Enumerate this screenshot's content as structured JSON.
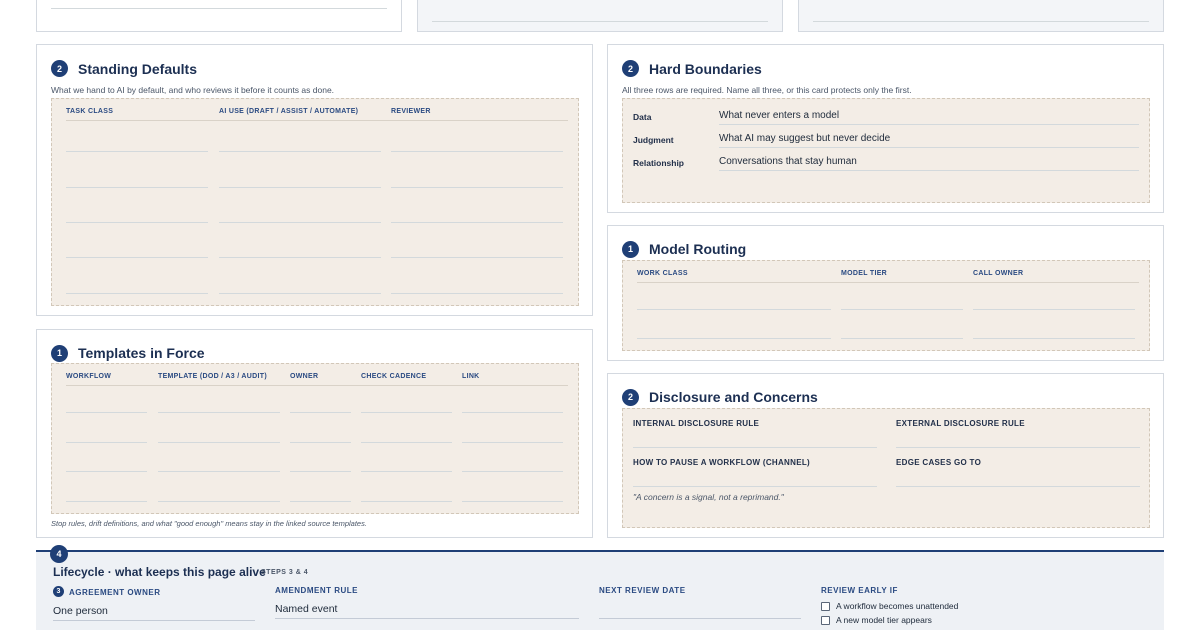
{
  "standing_defaults": {
    "step": "2",
    "title": "Standing Defaults",
    "subtitle": "What we hand to AI by default, and who reviews it before it counts as done.",
    "columns": [
      "TASK CLASS",
      "AI USE (DRAFT / ASSIST / AUTOMATE)",
      "REVIEWER"
    ]
  },
  "templates": {
    "step": "1",
    "title": "Templates in Force",
    "columns": [
      "WORKFLOW",
      "TEMPLATE (DOD / A3 / AUDIT)",
      "OWNER",
      "CHECK CADENCE",
      "LINK"
    ],
    "footnote": "Stop rules, drift definitions, and what \"good enough\" means stay in the linked source templates."
  },
  "hard_boundaries": {
    "step": "2",
    "title": "Hard Boundaries",
    "subtitle": "All three rows are required. Name all three, or this card protects only the first.",
    "rows": [
      {
        "label": "Data",
        "value": "What never enters a model"
      },
      {
        "label": "Judgment",
        "value": "What AI may suggest but never decide"
      },
      {
        "label": "Relationship",
        "value": "Conversations that stay human"
      }
    ]
  },
  "model_routing": {
    "step": "1",
    "title": "Model Routing",
    "columns": [
      "WORK CLASS",
      "MODEL TIER",
      "CALL OWNER"
    ]
  },
  "disclosure": {
    "step": "2",
    "title": "Disclosure and Concerns",
    "internal": "INTERNAL DISCLOSURE RULE",
    "external": "EXTERNAL DISCLOSURE RULE",
    "pause": "HOW TO PAUSE A WORKFLOW (CHANNEL)",
    "edge": "EDGE CASES GO TO",
    "quote": "\"A concern is a signal, not a reprimand.\""
  },
  "lifecycle": {
    "step": "4",
    "title": "Lifecycle · what keeps this page alive",
    "steps": "STEPS 3 & 4",
    "owner_step": "3",
    "owner_label": "AGREEMENT OWNER",
    "owner_value": "One person",
    "amendment_label": "AMENDMENT RULE",
    "amendment_value": "Named event",
    "review_label": "NEXT REVIEW DATE",
    "early_label": "REVIEW EARLY IF",
    "early_items": [
      "A workflow becomes unattended",
      "A new model tier appears"
    ]
  }
}
